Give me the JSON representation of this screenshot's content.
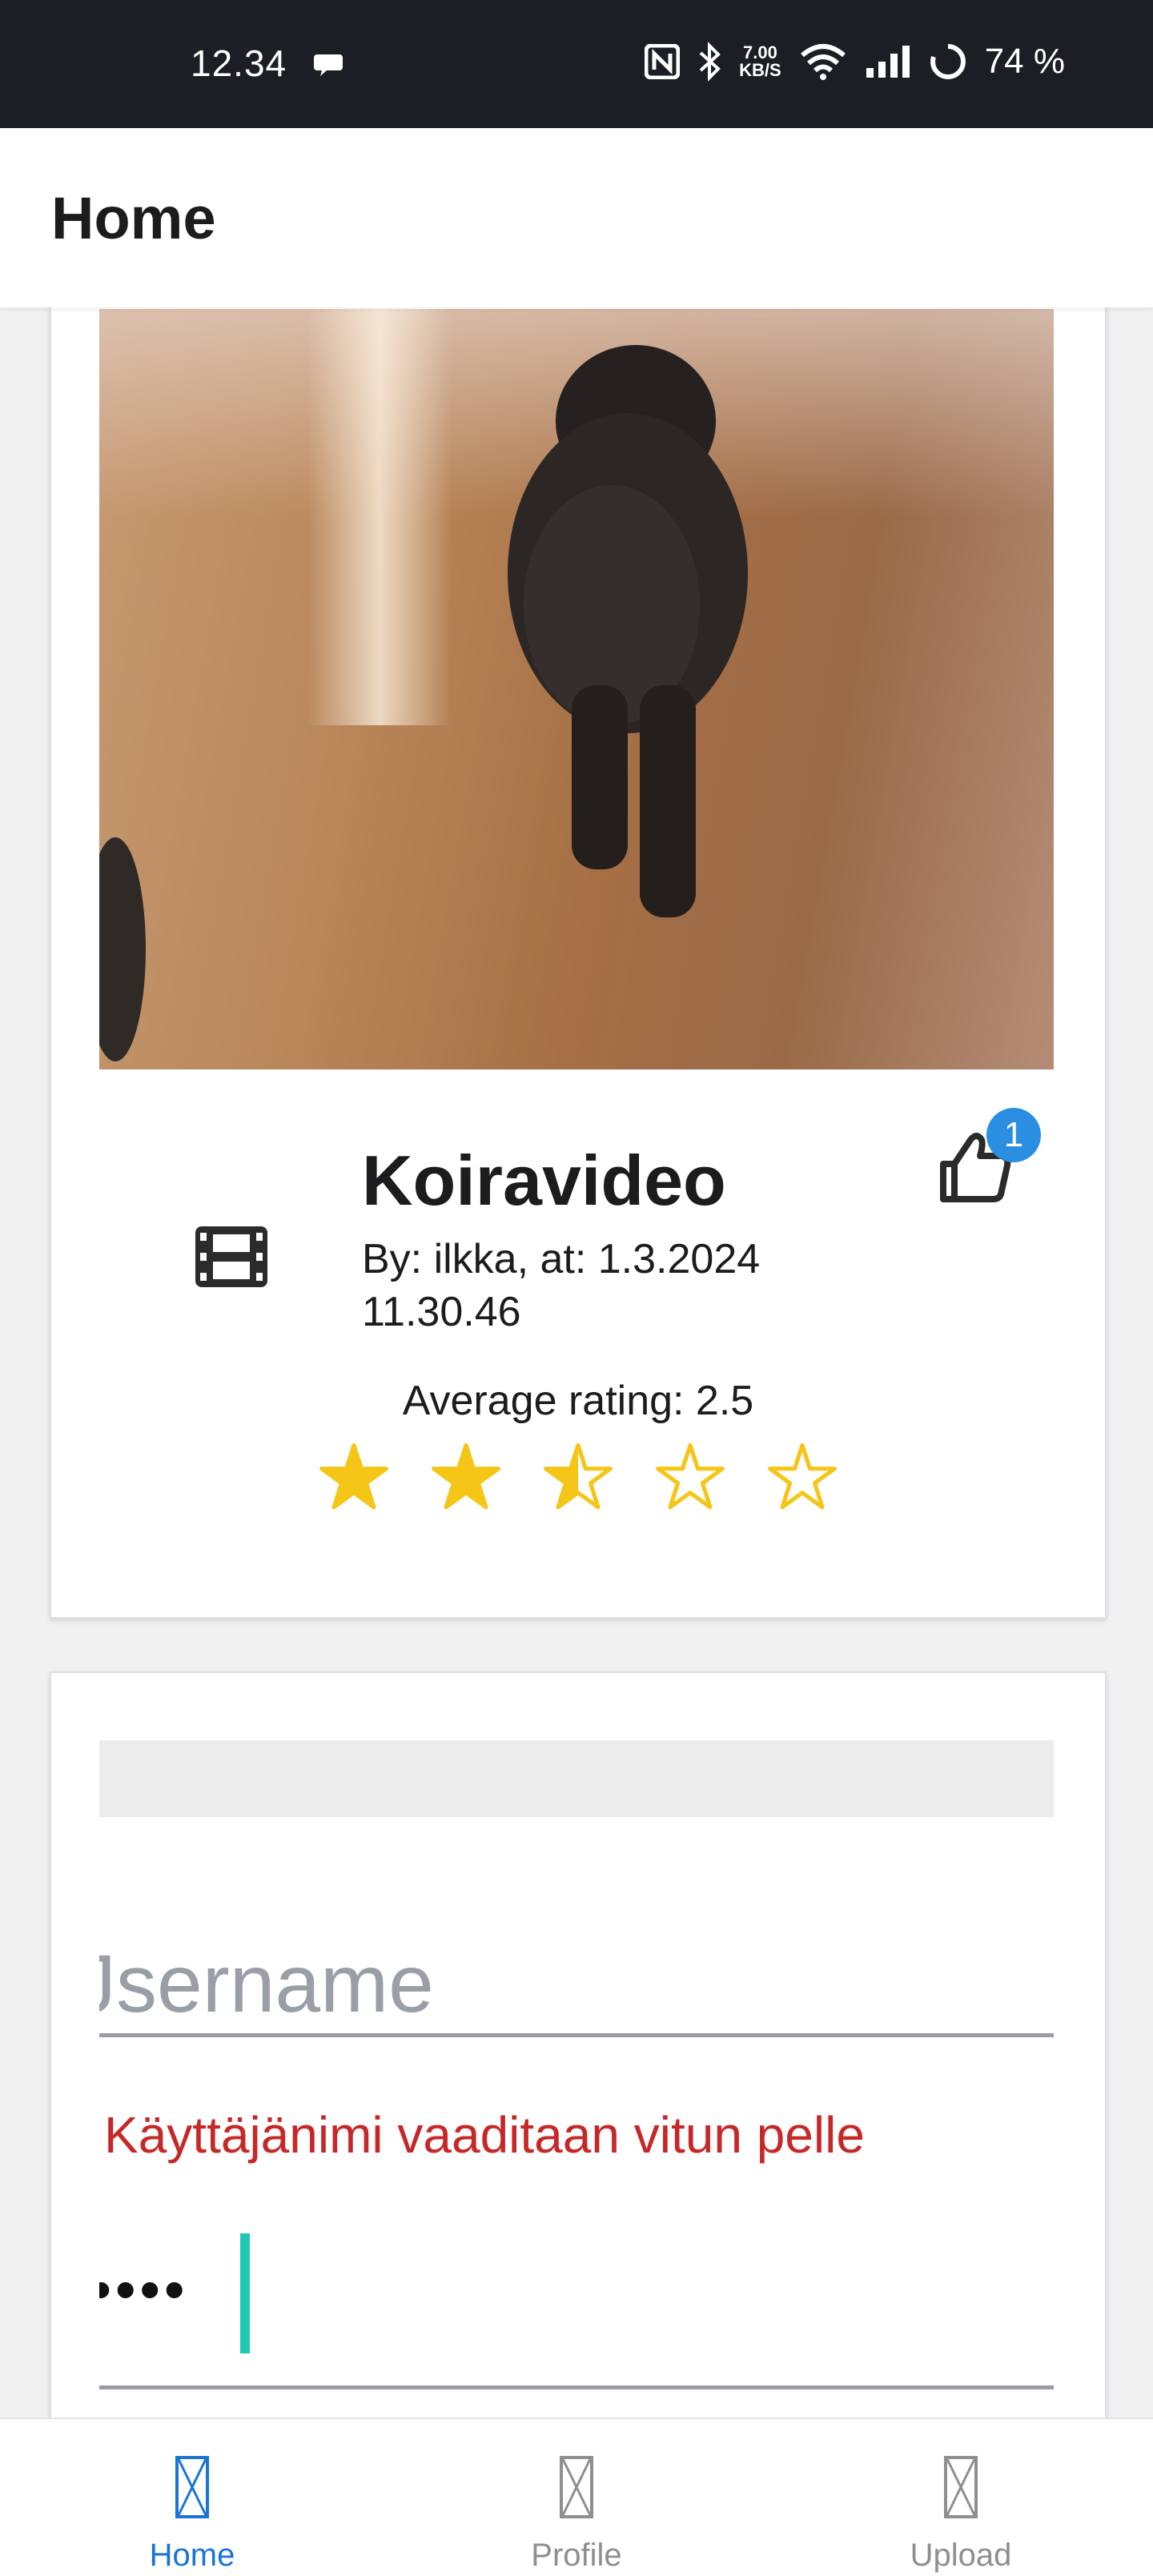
{
  "status_bar": {
    "time": "12.34",
    "battery": "74 %",
    "net_speed_value": "7.00",
    "net_speed_unit": "KB/S",
    "icons": [
      "chat-bubble-icon",
      "nfc-icon",
      "bluetooth-icon",
      "wifi-icon",
      "signal-icon",
      "battery-ring-icon"
    ]
  },
  "header": {
    "title": "Home"
  },
  "post": {
    "title": "Koiravideo",
    "meta": "By: ilkka, at: 1.3.2024 11.30.46",
    "type_icon": "film-icon",
    "like_icon": "thumbs-up-icon",
    "likes": "1",
    "average_rating_text": "Average rating: 2.5",
    "rating": {
      "value": 2.5,
      "max": 5
    },
    "star_color": "#f5c518"
  },
  "form": {
    "username_placeholder": "Jsername",
    "error": "Käyttäjänimi vaaditaan vitun pelle",
    "password_value": "••••",
    "caret_color": "#1fc8b5",
    "error_color": "#c62828"
  },
  "tabs": [
    {
      "label": "Home",
      "icon": "home-icon",
      "active": true
    },
    {
      "label": "Profile",
      "icon": "profile-icon",
      "active": false
    },
    {
      "label": "Upload",
      "icon": "upload-icon",
      "active": false
    }
  ],
  "colors": {
    "accent": "#1a74d6",
    "badge": "#2a8fe0",
    "status_bar": "#1b1e24"
  }
}
